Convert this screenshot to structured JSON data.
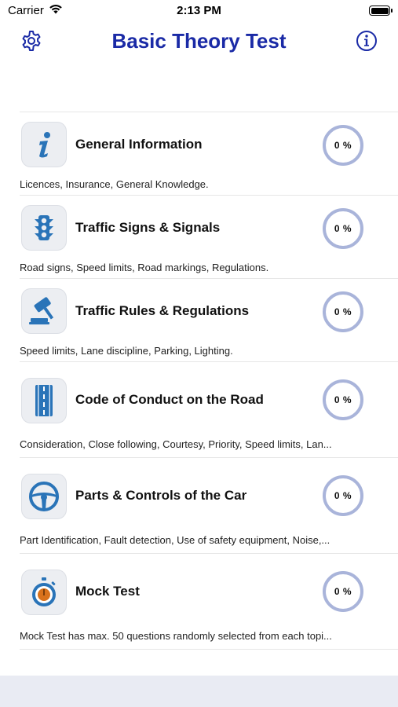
{
  "status_bar": {
    "carrier": "Carrier",
    "time": "2:13 PM",
    "icons": [
      "wifi-icon",
      "battery-icon"
    ]
  },
  "nav": {
    "title": "Basic Theory Test",
    "left_icon": "gear-icon",
    "right_icon": "info-circle-icon",
    "accent_color": "#1a2aa6"
  },
  "topics": [
    {
      "title": "General Information",
      "description": "Licences, Insurance, General Knowledge.",
      "progress": "0 %",
      "icon": "info-icon"
    },
    {
      "title": "Traffic Signs & Signals",
      "description": "Road signs, Speed limits, Road markings, Regulations.",
      "progress": "0 %",
      "icon": "traffic-light-icon"
    },
    {
      "title": "Traffic Rules & Regulations",
      "description": "Speed limits, Lane discipline, Parking, Lighting.",
      "progress": "0 %",
      "icon": "gavel-icon"
    },
    {
      "title": "Code of Conduct on the Road",
      "description": "Consideration, Close following, Courtesy, Priority, Speed limits, Lan...",
      "progress": "0 %",
      "icon": "road-icon"
    },
    {
      "title": "Parts & Controls of the Car",
      "description": "Part Identification, Fault detection, Use of safety equipment, Noise,...",
      "progress": "0 %",
      "icon": "steering-wheel-icon"
    },
    {
      "title": "Mock Test",
      "description": "Mock Test has max. 50 questions randomly selected from each topi...",
      "progress": "0 %",
      "icon": "stopwatch-icon"
    }
  ],
  "colors": {
    "progress_ring": "#a9b4da",
    "icon_blue": "#2a74b8",
    "bottom_band": "#e9ebf3"
  }
}
